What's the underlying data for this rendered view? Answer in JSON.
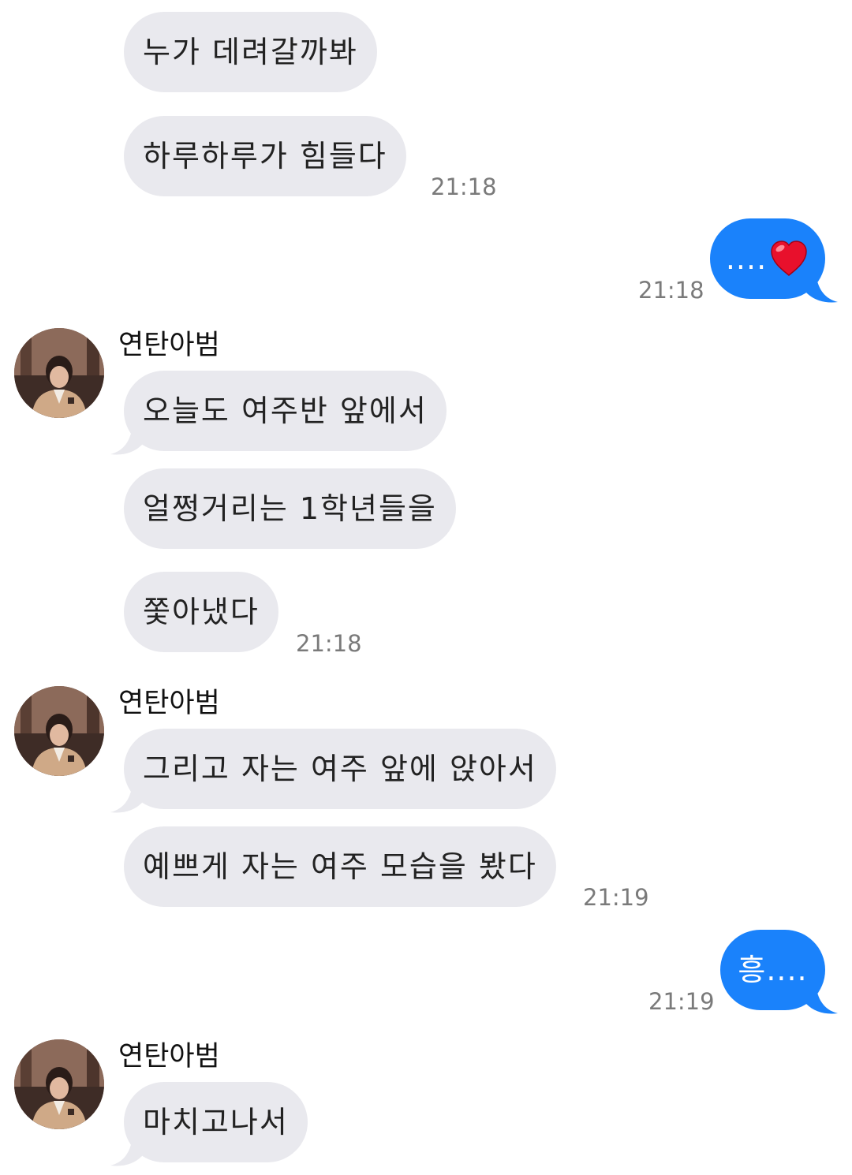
{
  "messages": [
    {
      "text": "누가 데려갈까봐"
    },
    {
      "text": "하루하루가 힘들다",
      "time": "21:18"
    },
    {
      "text": "....",
      "emoji_icon": "red-heart-icon",
      "time": "21:18"
    },
    {
      "sender": "연탄아범",
      "text": "오늘도 여주반 앞에서"
    },
    {
      "text": "얼쩡거리는 1학년들을"
    },
    {
      "text": "쫓아냈다",
      "time": "21:18"
    },
    {
      "sender": "연탄아범",
      "text": "그리고 자는 여주 앞에 앉아서"
    },
    {
      "text": "예쁘게 자는 여주 모습을 봤다",
      "time": "21:19"
    },
    {
      "text": "흥....",
      "time": "21:19"
    },
    {
      "sender": "연탄아범",
      "text": "마치고나서"
    }
  ],
  "colors": {
    "incoming_bubble": "#e9e9ee",
    "outgoing_bubble": "#1a82fb",
    "timestamp": "#7a7a7a"
  }
}
